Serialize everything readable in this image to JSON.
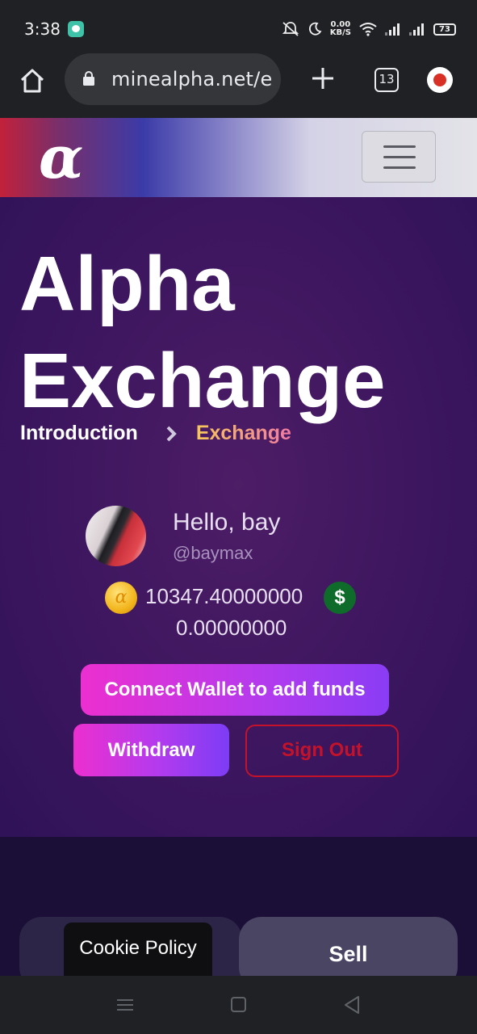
{
  "status_bar": {
    "time": "3:38",
    "net_speed_value": "0.00",
    "net_speed_unit": "KB/S",
    "battery": "73"
  },
  "browser": {
    "url": "minealpha.net/ex",
    "tab_count": "13"
  },
  "site_header": {
    "logo": "α"
  },
  "hero": {
    "title_line1": "Alpha",
    "title_line2": "Exchange",
    "breadcrumb": [
      "Introduction",
      "Exchange"
    ]
  },
  "profile": {
    "greeting": "Hello, bay",
    "handle": "@baymax",
    "coin_symbol": "α",
    "coin_balance": "10347.40000000",
    "dollar_symbol": "$",
    "dollar_balance": "0.00000000"
  },
  "actions": {
    "connect_wallet": "Connect Wallet to add funds",
    "withdraw": "Withdraw",
    "sign_out": "Sign Out"
  },
  "trade_tabs": {
    "sell": "Sell"
  },
  "cookie": {
    "label": "Cookie Policy"
  },
  "colors": {
    "accent_pink": "#ec2fcf",
    "accent_purple": "#8a3cf5",
    "danger_red": "#c4122a",
    "hero_bg": "#3f1760"
  }
}
